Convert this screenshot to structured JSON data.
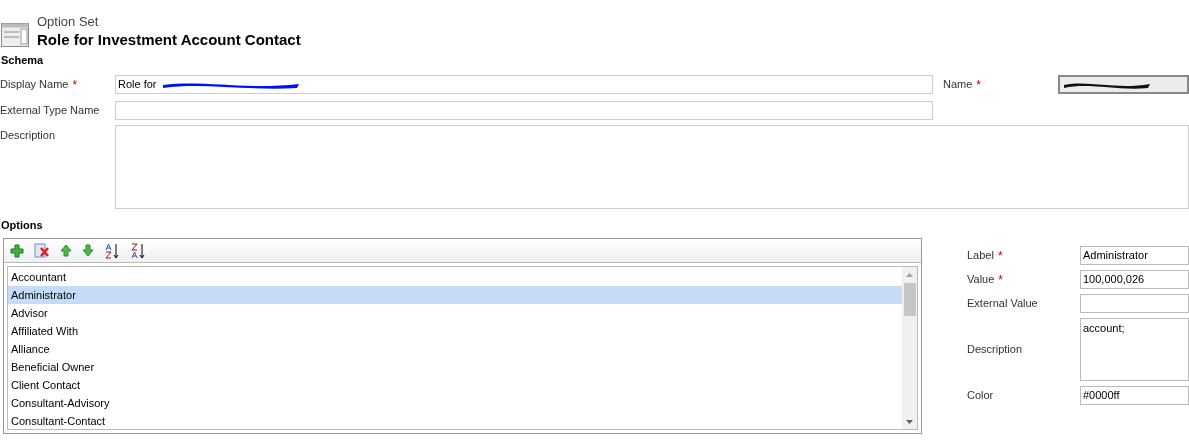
{
  "header": {
    "entity_type": "Option Set",
    "title": "Role for Investment Account Contact"
  },
  "schema": {
    "heading": "Schema",
    "display_name": {
      "label": "Display Name",
      "required_mark": "*",
      "value": "Role for"
    },
    "name": {
      "label": "Name",
      "required_mark": "*"
    },
    "external_type_name": {
      "label": "External Type Name"
    },
    "description": {
      "label": "Description"
    }
  },
  "options": {
    "heading": "Options",
    "items": [
      {
        "label": "Accountant",
        "selected": false
      },
      {
        "label": "Administrator",
        "selected": true
      },
      {
        "label": "Advisor",
        "selected": false
      },
      {
        "label": "Affiliated With",
        "selected": false
      },
      {
        "label": "Alliance",
        "selected": false
      },
      {
        "label": "Beneficial Owner",
        "selected": false
      },
      {
        "label": "Client Contact",
        "selected": false
      },
      {
        "label": "Consultant-Advisory",
        "selected": false
      },
      {
        "label": "Consultant-Contact",
        "selected": false
      }
    ],
    "details": [
      {
        "kind": "input",
        "label": "Label",
        "required_mark": "*",
        "value": "Administrator"
      },
      {
        "kind": "input",
        "label": "Value",
        "required_mark": "*",
        "value": "100,000,026"
      },
      {
        "kind": "input",
        "label": "External Value"
      },
      {
        "kind": "textarea",
        "label": "Description",
        "value": "account;"
      },
      {
        "kind": "input",
        "label": "Color",
        "value": "#0000ff"
      }
    ]
  }
}
